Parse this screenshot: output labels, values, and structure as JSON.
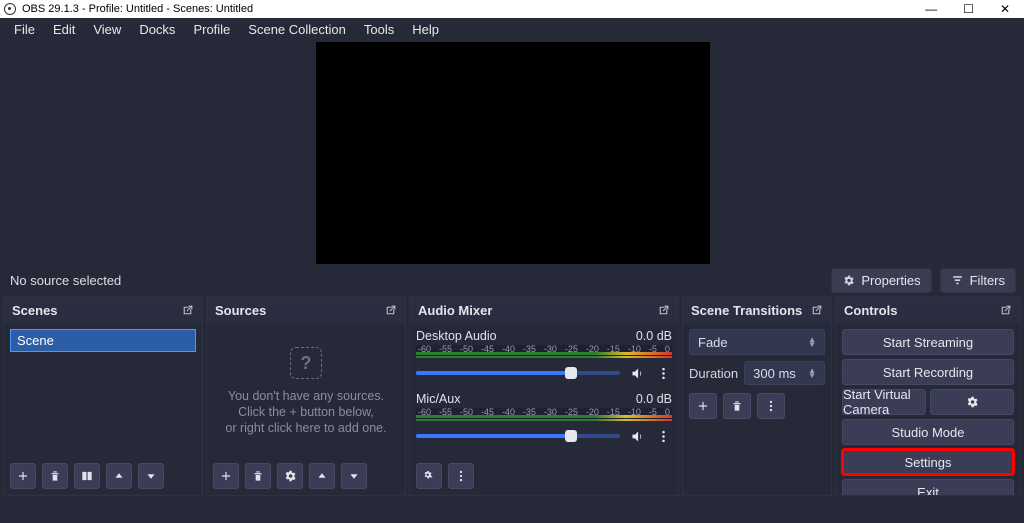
{
  "titlebar": {
    "text": "OBS 29.1.3 - Profile: Untitled - Scenes: Untitled"
  },
  "menu": [
    "File",
    "Edit",
    "View",
    "Docks",
    "Profile",
    "Scene Collection",
    "Tools",
    "Help"
  ],
  "info_strip": {
    "no_source": "No source selected",
    "properties": "Properties",
    "filters": "Filters"
  },
  "scenes": {
    "title": "Scenes",
    "items": [
      "Scene"
    ]
  },
  "sources": {
    "title": "Sources",
    "empty1": "You don't have any sources.",
    "empty2": "Click the + button below,",
    "empty3": "or right click here to add one."
  },
  "mixer": {
    "title": "Audio Mixer",
    "channels": [
      {
        "name": "Desktop Audio",
        "db": "0.0 dB",
        "ticks": [
          "-60",
          "-55",
          "-50",
          "-45",
          "-40",
          "-35",
          "-30",
          "-25",
          "-20",
          "-15",
          "-10",
          "-5",
          "0"
        ]
      },
      {
        "name": "Mic/Aux",
        "db": "0.0 dB",
        "ticks": [
          "-60",
          "-55",
          "-50",
          "-45",
          "-40",
          "-35",
          "-30",
          "-25",
          "-20",
          "-15",
          "-10",
          "-5",
          "0"
        ]
      }
    ]
  },
  "transitions": {
    "title": "Scene Transitions",
    "selected": "Fade",
    "duration_label": "Duration",
    "duration": "300 ms"
  },
  "controls": {
    "title": "Controls",
    "start_streaming": "Start Streaming",
    "start_recording": "Start Recording",
    "start_virtual_camera": "Start Virtual Camera",
    "studio_mode": "Studio Mode",
    "settings": "Settings",
    "exit": "Exit"
  },
  "colors": {
    "accent": "#3878ff",
    "highlight": "#ff0000"
  }
}
